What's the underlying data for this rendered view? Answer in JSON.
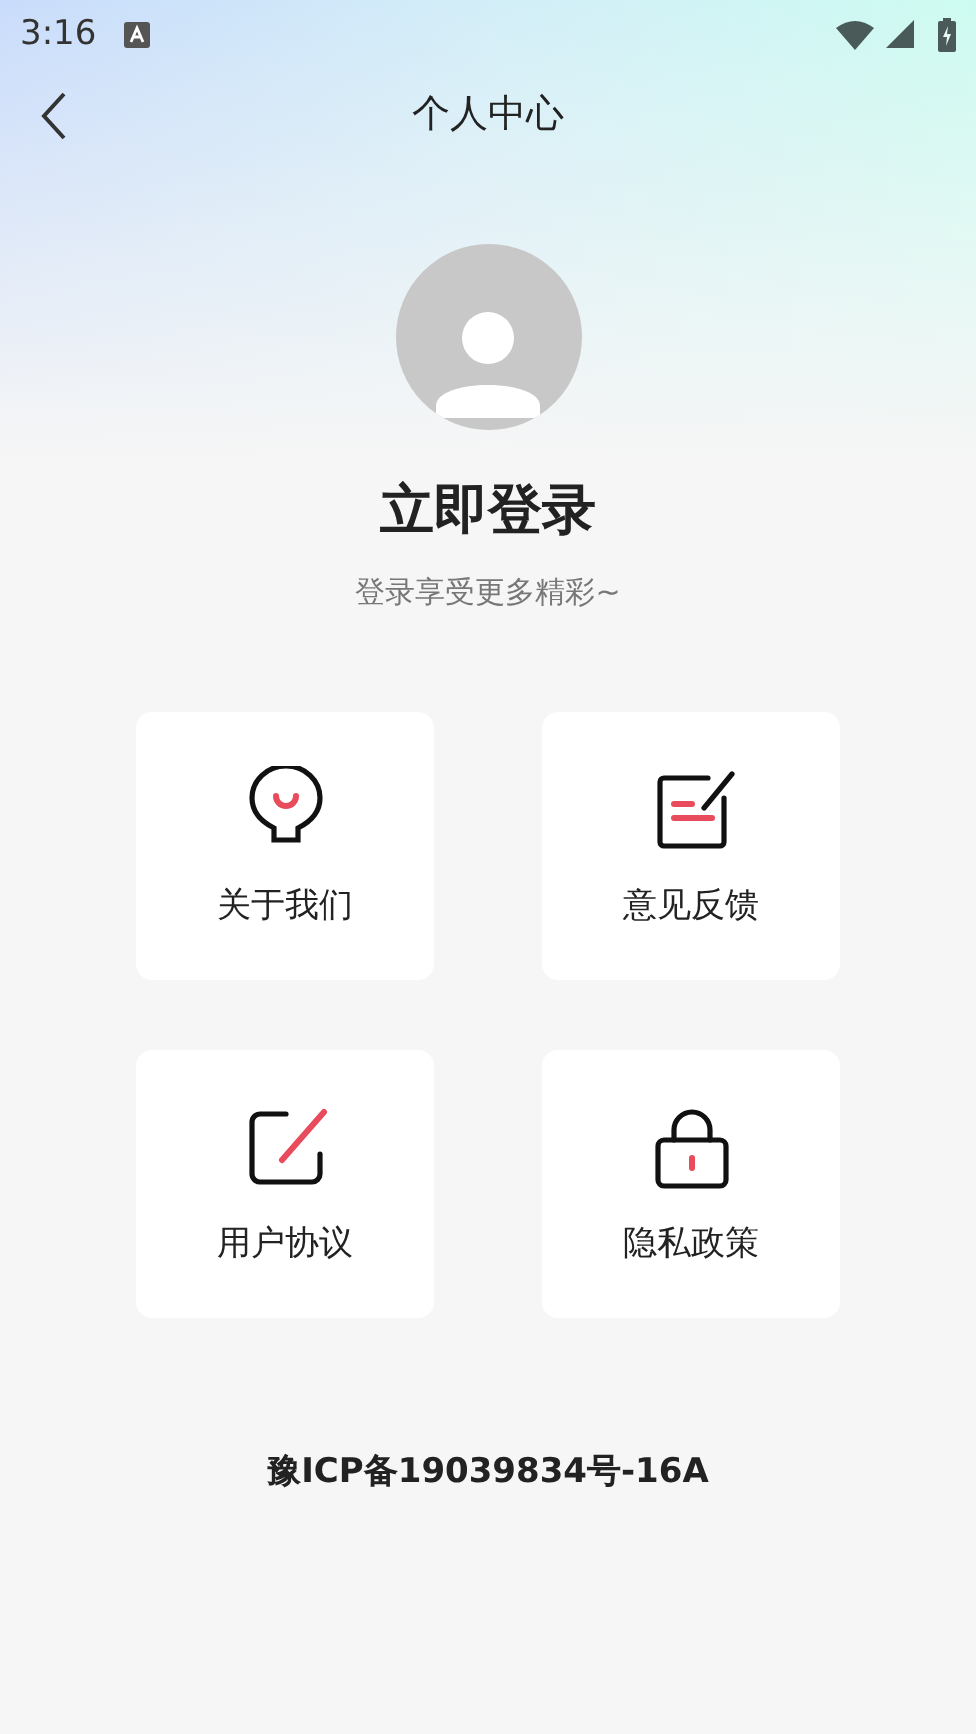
{
  "status_bar": {
    "time": "3:16"
  },
  "header": {
    "title": "个人中心"
  },
  "profile": {
    "title": "立即登录",
    "subtitle": "登录享受更多精彩~"
  },
  "menu": [
    {
      "kind": "about",
      "label": "关于我们"
    },
    {
      "kind": "feedback",
      "label": "意见反馈"
    },
    {
      "kind": "agreement",
      "label": "用户协议"
    },
    {
      "kind": "privacy",
      "label": "隐私政策"
    }
  ],
  "footer": {
    "icp": "豫ICP备19039834号-16A"
  }
}
